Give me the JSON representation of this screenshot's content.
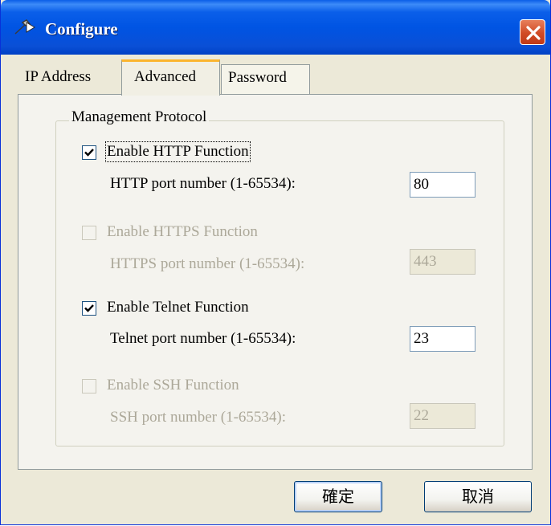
{
  "window": {
    "title": "Configure"
  },
  "tabs": [
    {
      "label": "IP Address",
      "active": false
    },
    {
      "label": "Advanced",
      "active": true
    },
    {
      "label": "Password",
      "active": false
    }
  ],
  "group": {
    "legend": "Management Protocol"
  },
  "options": [
    {
      "checkbox_label": "Enable HTTP Function",
      "checked": true,
      "enabled": true,
      "port_label": "HTTP port number (1-65534):",
      "port_value": "80"
    },
    {
      "checkbox_label": "Enable HTTPS Function",
      "checked": false,
      "enabled": false,
      "port_label": "HTTPS port number (1-65534):",
      "port_value": "443"
    },
    {
      "checkbox_label": "Enable Telnet Function",
      "checked": true,
      "enabled": true,
      "port_label": "Telnet port number (1-65534):",
      "port_value": "23"
    },
    {
      "checkbox_label": "Enable SSH Function",
      "checked": false,
      "enabled": false,
      "port_label": "SSH port number (1-65534):",
      "port_value": "22"
    }
  ],
  "buttons": {
    "ok": "確定",
    "cancel": "取消"
  },
  "icons": {
    "title": "wrench-arrow-icon",
    "close": "close-icon",
    "check": "checkmark-icon"
  },
  "colors": {
    "titlebar": "#0054e3",
    "close_button": "#d04a25",
    "tab_highlight": "#fbb52f",
    "dialog_bg": "#ece9d8"
  }
}
